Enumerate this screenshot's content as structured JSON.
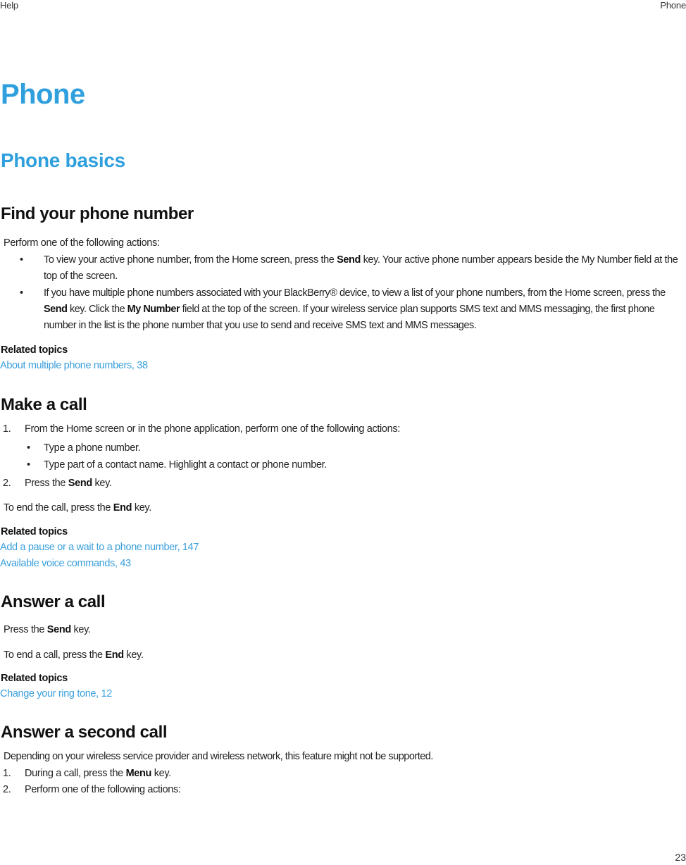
{
  "header": {
    "left": "Help",
    "right": "Phone"
  },
  "footer": {
    "page_number": "23"
  },
  "chapter_title": "Phone",
  "section_title": "Phone basics",
  "topics": {
    "find_number": {
      "title": "Find your phone number",
      "intro": "Perform one of the following actions:",
      "bullets": [
        {
          "pre": "To view your active phone number, from the Home screen, press the ",
          "bold": "Send",
          "post": " key. Your active phone number appears beside the My Number field at the top of the screen."
        },
        {
          "pre": "If you have multiple phone numbers associated with your BlackBerry® device, to view a list of your phone numbers, from the Home screen, press the ",
          "bold": "Send",
          "mid": " key. Click the ",
          "bold2": "My Number",
          "post": " field at the top of the screen. If your wireless service plan supports SMS text and MMS messaging, the first phone number in the list is the phone number that you use to send and receive SMS text and MMS messages."
        }
      ],
      "related_label": "Related topics",
      "related": [
        "About multiple phone numbers, 38"
      ]
    },
    "make_call": {
      "title": "Make a call",
      "steps": [
        {
          "num": "1.",
          "text": "From the Home screen or in the phone application, perform one of the following actions:",
          "sub": [
            "Type a phone number.",
            "Type part of a contact name. Highlight a contact or phone number."
          ]
        },
        {
          "num": "2.",
          "pre": "Press the ",
          "bold": "Send",
          "post": " key."
        }
      ],
      "note": {
        "pre": "To end the call, press the ",
        "bold": "End",
        "post": " key."
      },
      "related_label": "Related topics",
      "related": [
        "Add a pause or a wait to a phone number, 147",
        "Available voice commands, 43"
      ]
    },
    "answer_call": {
      "title": "Answer a call",
      "line1": {
        "pre": "Press the ",
        "bold": "Send",
        "post": " key."
      },
      "line2": {
        "pre": "To end a call, press the ",
        "bold": "End",
        "post": " key."
      },
      "related_label": "Related topics",
      "related": [
        "Change your ring tone, 12"
      ]
    },
    "answer_second": {
      "title": "Answer a second call",
      "intro": "Depending on your wireless service provider and wireless network, this feature might not be supported.",
      "steps": [
        {
          "num": "1.",
          "pre": "During a call, press the ",
          "bold": "Menu",
          "post": " key."
        },
        {
          "num": "2.",
          "text": "Perform one of the following actions:"
        }
      ]
    }
  },
  "bullet_glyph": "•",
  "colors": {
    "heading_blue": "#2f9fdd",
    "link_blue": "#3aa0dc",
    "text": "#222222"
  }
}
